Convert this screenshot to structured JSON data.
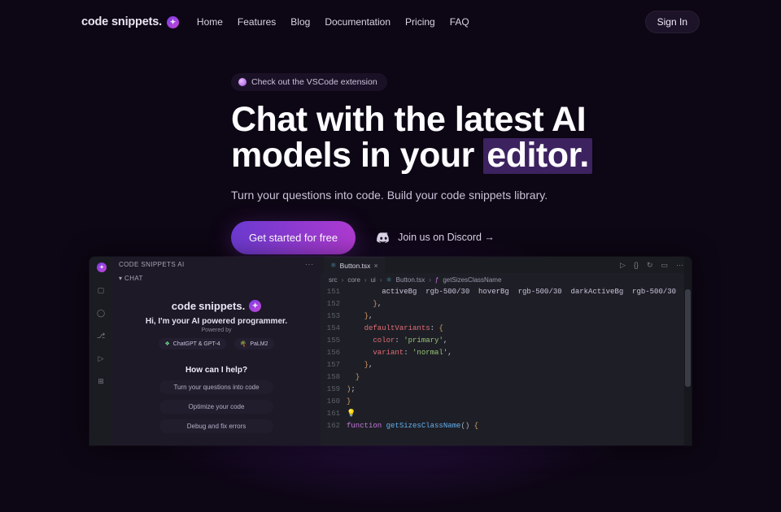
{
  "nav": {
    "logo_prefix": "code",
    "logo_bold": "snippets.",
    "links": [
      "Home",
      "Features",
      "Blog",
      "Documentation",
      "Pricing",
      "FAQ"
    ],
    "signin": "Sign In"
  },
  "hero": {
    "pill": "Check out the VSCode extension",
    "headline_line1": "Chat with the latest AI",
    "headline_line2_prefix": "models in your ",
    "headline_highlight": "editor.",
    "subtitle": "Turn your questions into code. Build your code snippets library.",
    "cta_primary": "Get started for free",
    "cta_secondary": "Join us on Discord →"
  },
  "preview": {
    "sidebar_title": "CODE SNIPPETS AI",
    "chat_label": "▾ CHAT",
    "sidebar_logo_prefix": "code",
    "sidebar_logo_bold": "snippets.",
    "hi": "Hi, I'm your AI powered programmer.",
    "powered": "Powered by",
    "models": [
      "ChatGPT & GPT-4",
      "PaLM2"
    ],
    "help_title": "How can I help?",
    "suggestions": [
      "Turn your questions into code",
      "Optimize your code",
      "Debug and fix errors"
    ],
    "tab_name": "Button.tsx",
    "breadcrumb": [
      "src",
      "core",
      "ui",
      "Button.tsx",
      "getSizesClassName"
    ],
    "code_lines": [
      {
        "n": 151,
        "html": "        activeBg  rgb-500/30  hoverBg  rgb-500/30  darkActiveBg  rgb-500/30  ,"
      },
      {
        "n": 152,
        "html": "      <span class='tok-brace'>}</span>,"
      },
      {
        "n": 153,
        "html": "    <span class='tok-brace'>}</span>,"
      },
      {
        "n": 154,
        "html": "    <span class='tok-prop'>defaultVariants</span>: <span class='tok-brace'>{</span>"
      },
      {
        "n": 155,
        "html": "      <span class='tok-prop'>color</span>: <span class='tok-str'>'primary'</span>,"
      },
      {
        "n": 156,
        "html": "      <span class='tok-prop'>variant</span>: <span class='tok-str'>'normal'</span>,"
      },
      {
        "n": 157,
        "html": "    <span class='tok-brace'>}</span>,"
      },
      {
        "n": 158,
        "html": "  <span class='tok-brace'>}</span>"
      },
      {
        "n": 159,
        "html": "<span class='tok-brace'>)</span>;"
      },
      {
        "n": 160,
        "html": "<span class='tok-brace'>}</span>"
      },
      {
        "n": 161,
        "html": "<span class='tok-bulb'>💡</span>"
      },
      {
        "n": 162,
        "html": "<span class='tok-kw'>function</span> <span class='tok-fn'>getSizesClassName</span><span class='tok-punc'>()</span> <span class='tok-brace'>{</span>"
      }
    ]
  }
}
